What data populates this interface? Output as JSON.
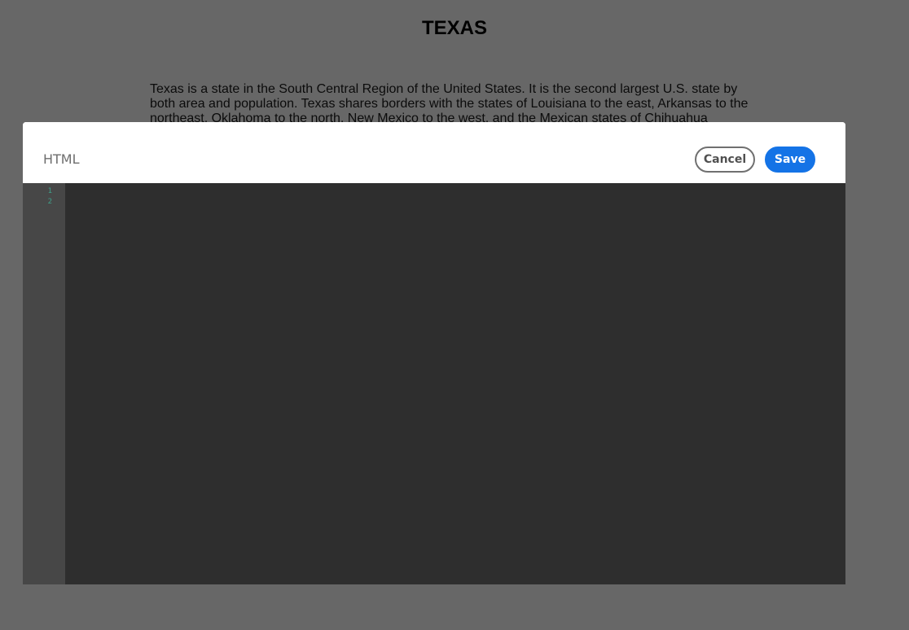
{
  "page": {
    "title": "TEXAS",
    "paragraph": "Texas is a state in the South Central Region of the United States. It is the second largest U.S. state by both area and population. Texas shares borders with the states of Louisiana to the east, Arkansas to the northeast, Oklahoma to the north, New Mexico to the west, and the Mexican states of Chihuahua"
  },
  "modal": {
    "title": "HTML",
    "cancel_label": "Cancel",
    "save_label": "Save",
    "editor": {
      "line_numbers": [
        "1",
        "2"
      ]
    }
  },
  "colors": {
    "overlay": "#676767",
    "accent": "#1473e6",
    "editor_background": "#2e2e2e",
    "gutter_background": "#474747",
    "line_number": "#3fa08a"
  }
}
